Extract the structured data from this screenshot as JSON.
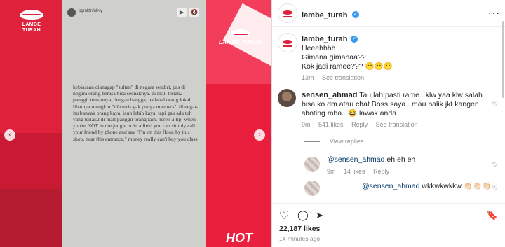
{
  "media": {
    "logo_left": "LAMBE TURAH",
    "logo_right": "LAMBE TURAH",
    "story_username": "bgrnkfnfnlnly",
    "story_text": "kebiasaan dianggap \"sultan\" di negara sendiri, pas di negara orang berasa bisa seenaknya. di mall teriak2 panggil temannya, dengan bangga, padahal orang lokal lihatnya mungkin \"nih turis gak punya manners\". di negara itu banyak orang kaya, jauh lebih kaya, tapi gak ada tuh yang teriak2 di mall panggil orang lain. here's a tip: when you're NOT in the jungle or in a field you can simply call your friend by phone and say \"I'm on this floor, by this shop, near this entrance.\" money really can't buy you class.",
    "hot_text": "HOT",
    "prev_icon": "‹",
    "next_icon": "›",
    "play_icon": "▶",
    "mute_icon": "🔇"
  },
  "header": {
    "username": "lambe_turah",
    "verified_icon": "✓",
    "more_icon": "···"
  },
  "caption": {
    "username": "lambe_turah",
    "line1": "Heeehhhh",
    "line2": "Gimana gimanaa??",
    "line3": "Kok jadi ramee??? 😶😶😶",
    "time": "13m",
    "see_translation": "See translation"
  },
  "comment1": {
    "username": "sensen_ahmad",
    "text": "Tau lah pasti rame.. klw yaa klw salah bisa ko dm atau chat Boss saya.. mau balik jkt kangen shoting mba.. 😂 lawak anda",
    "time": "9m",
    "likes": "541 likes",
    "reply": "Reply",
    "see_translation": "See translation",
    "view_replies": "View replies"
  },
  "reply1": {
    "mention": "@sensen_ahmad",
    "text": "eh eh eh",
    "time": "9m",
    "likes": "14 likes",
    "reply": "Reply"
  },
  "reply2": {
    "mention": "@sensen_ahmad",
    "text": "wkkwkwkkw 👏🏻👏🏻👏🏻"
  },
  "actions": {
    "like_icon": "♡",
    "comment_icon": "◯",
    "share_icon": "➤",
    "save_icon": "🔖"
  },
  "likes": "22,187 likes",
  "posted": "14 minutes ago"
}
